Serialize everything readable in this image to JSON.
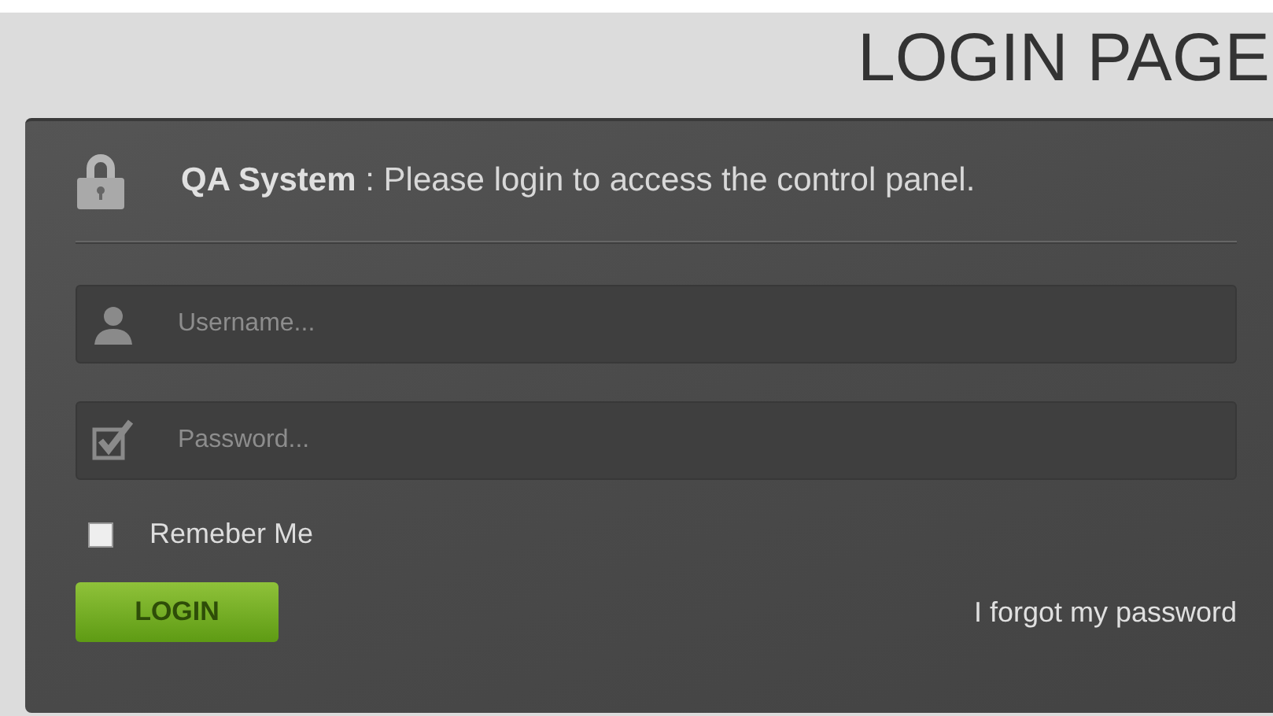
{
  "page_title": "LOGIN PAGE",
  "header": {
    "system_name": "QA System",
    "message": ": Please login to access the control panel."
  },
  "fields": [
    {
      "kind": "user",
      "placeholder": "Username..."
    },
    {
      "kind": "password",
      "placeholder": "Password..."
    }
  ],
  "remember": {
    "label": "Remeber Me",
    "checked": false
  },
  "login_button": "LOGIN",
  "forgot_link": "I forgot my password"
}
